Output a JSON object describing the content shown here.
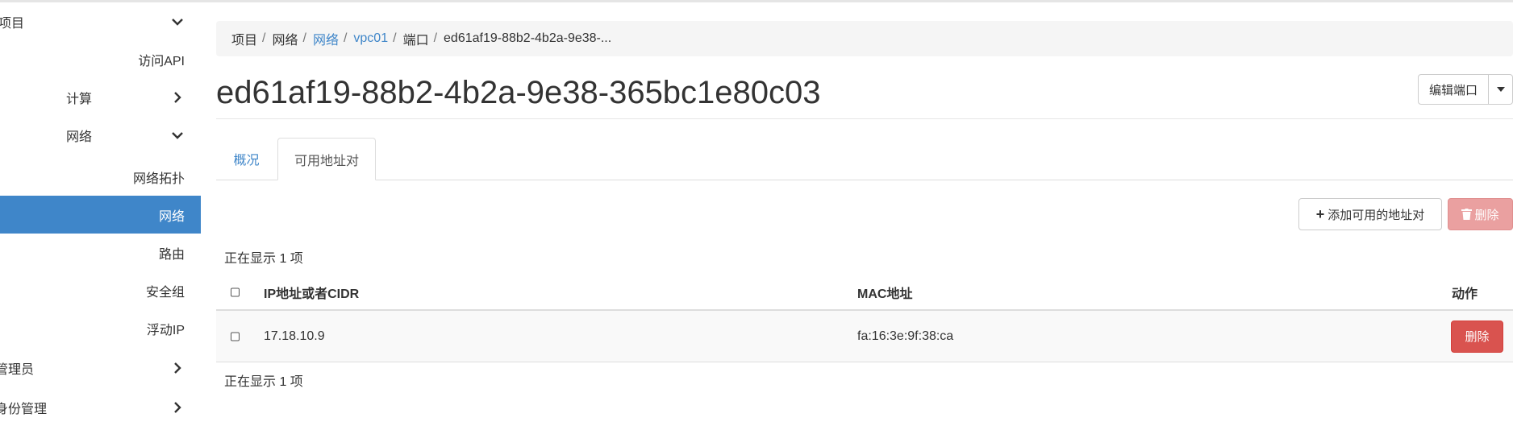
{
  "sidebar": {
    "items": [
      {
        "label": "项目",
        "chevron": "chevron-down"
      },
      {
        "label": "访问API"
      },
      {
        "label": "计算",
        "chevron": "chevron-right"
      },
      {
        "label": "网络",
        "chevron": "chevron-down"
      },
      {
        "label": "网络拓扑"
      },
      {
        "label": "网络",
        "active": true
      },
      {
        "label": "路由"
      },
      {
        "label": "安全组"
      },
      {
        "label": "浮动IP"
      },
      {
        "label": "管理员",
        "chevron": "chevron-right"
      },
      {
        "label": "身份管理",
        "chevron": "chevron-right"
      }
    ],
    "active_color": "#3f86c9"
  },
  "breadcrumb": {
    "items": [
      "项目",
      "网络",
      "网络",
      "vpc01",
      "端口",
      "ed61af19-88b2-4b2a-9e38-..."
    ]
  },
  "page": {
    "title": "ed61af19-88b2-4b2a-9e38-365bc1e80c03",
    "edit_button": "编辑端口"
  },
  "tabs": [
    {
      "label": "概况",
      "active": false
    },
    {
      "label": "可用地址对",
      "active": true
    }
  ],
  "actions": {
    "add_label": "添加可用的地址对",
    "delete_label": "删除"
  },
  "table": {
    "showing_top": "正在显示 1 项",
    "showing_bottom": "正在显示 1 项",
    "headers": [
      "IP地址或者CIDR",
      "MAC地址",
      "动作"
    ],
    "rows": [
      {
        "ip": "17.18.10.9",
        "mac": "fa:16:3e:9f:38:ca",
        "action": "删除"
      }
    ]
  },
  "colors": {
    "link": "#3f86c9",
    "danger": "#d9534f",
    "danger_disabled": "#eaa0a0"
  }
}
